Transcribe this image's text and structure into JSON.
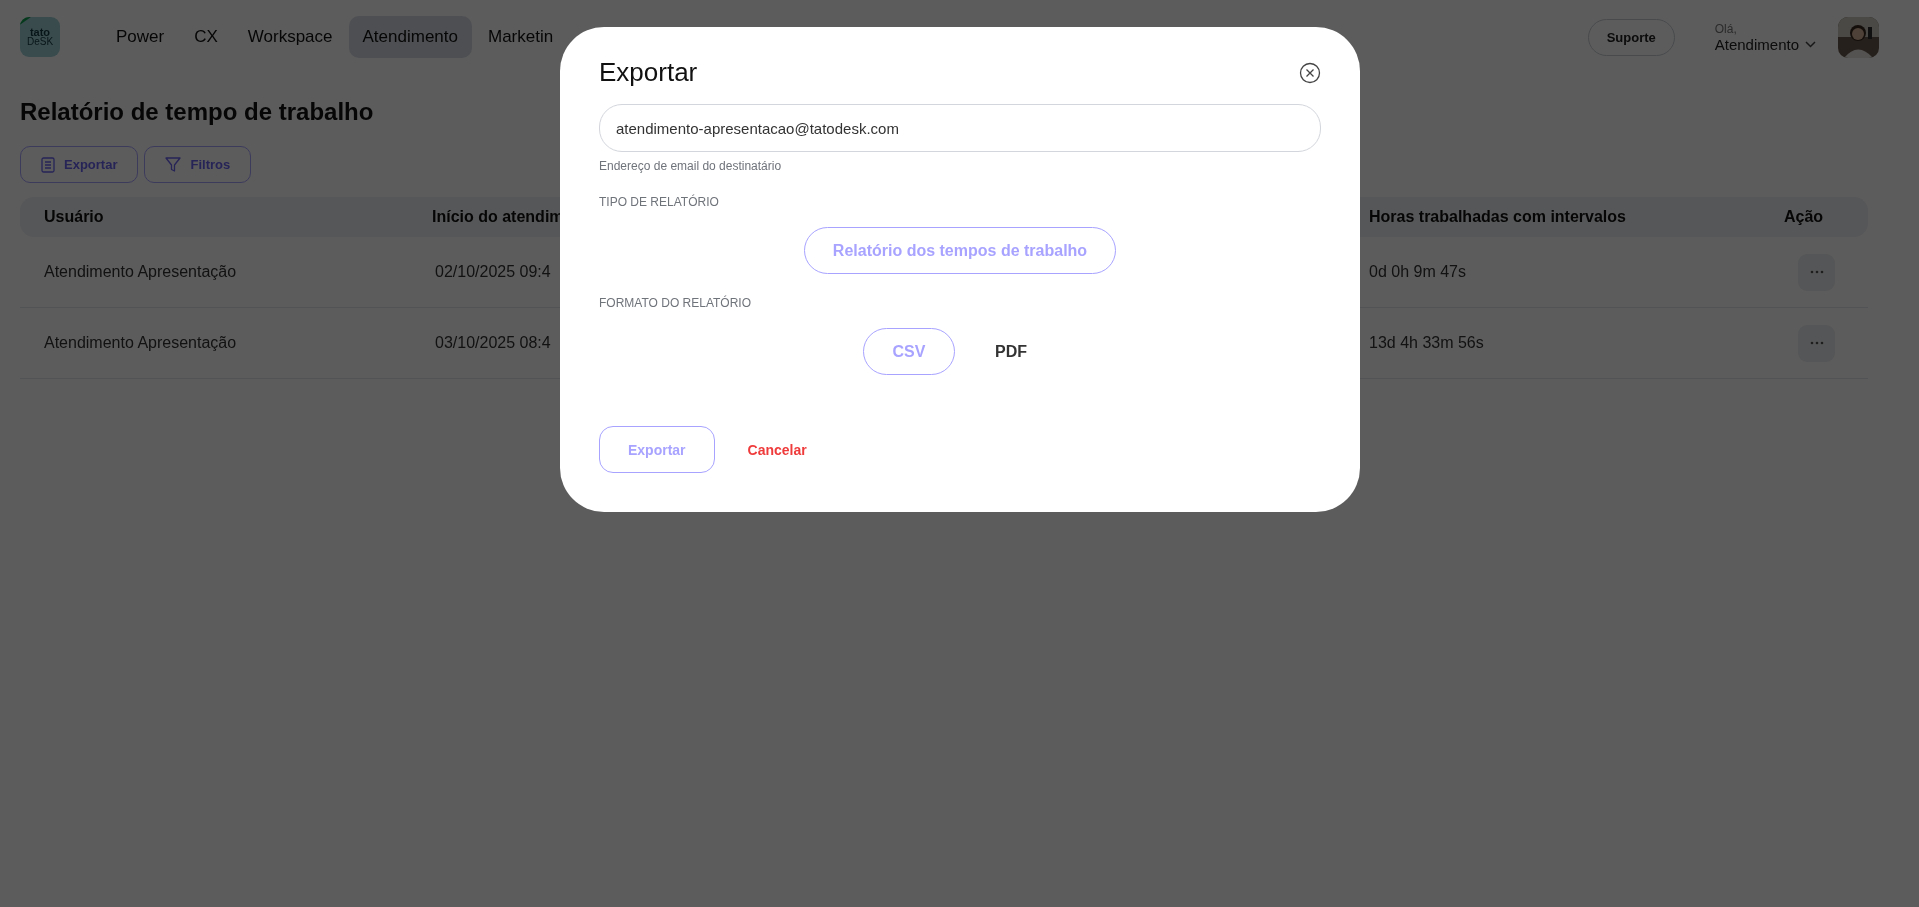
{
  "header": {
    "logo": {
      "line1": "tato",
      "line2": "DeSK"
    },
    "nav": [
      {
        "label": "Power",
        "selected": false
      },
      {
        "label": "CX",
        "selected": false
      },
      {
        "label": "Workspace",
        "selected": false
      },
      {
        "label": "Atendimento",
        "selected": true
      },
      {
        "label": "Marketin",
        "selected": false
      }
    ],
    "support_button": "Suporte",
    "greeting": "Olá,",
    "user_name": "Atendimento"
  },
  "page": {
    "title": "Relatório de tempo de trabalho",
    "toolbar": [
      {
        "label": "Exportar",
        "kind": "export"
      },
      {
        "label": "Filtros",
        "kind": "filter"
      }
    ]
  },
  "table": {
    "columns": [
      "Usuário",
      "Início do atendim",
      "Horas trabalhadas com intervalos",
      "Ação"
    ],
    "rows": [
      {
        "cells": [
          "Atendimento Apresentação",
          "02/10/2025 09:4",
          "0d 0h 9m 47s"
        ]
      },
      {
        "cells": [
          "Atendimento Apresentação",
          "03/10/2025 08:4",
          "13d 4h 33m 56s"
        ]
      }
    ]
  },
  "modal": {
    "title": "Exportar",
    "email": {
      "value": "atendimento-apresentacao@tatodesk.com",
      "helper": "Endereço de email do destinatário"
    },
    "report_type": {
      "label": "TIPO DE RELATÓRIO",
      "options": [
        {
          "label": "Relatório dos tempos de trabalho",
          "selected": true
        }
      ]
    },
    "format": {
      "label": "FORMATO DO RELATÓRIO",
      "options": [
        {
          "label": "CSV",
          "selected": true
        },
        {
          "label": "PDF",
          "selected": false
        }
      ]
    },
    "buttons": [
      {
        "label": "Exportar",
        "kind": "primary"
      },
      {
        "label": "Cancelar",
        "kind": "cancel"
      }
    ]
  }
}
